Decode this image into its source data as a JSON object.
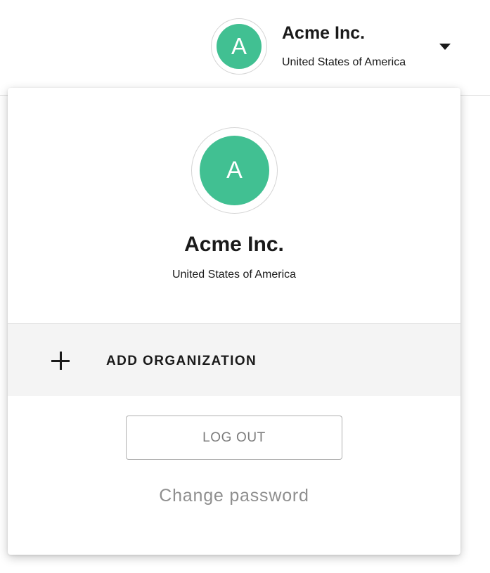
{
  "header": {
    "org_initial": "A",
    "org_name": "Acme Inc.",
    "org_country": "United States of America",
    "caret_icon": "caret-down-icon"
  },
  "menu": {
    "avatar_initial": "A",
    "org_name": "Acme Inc.",
    "org_country": "United States of America",
    "add_org_icon": "plus-icon",
    "add_org_label": "ADD ORGANIZATION",
    "logout_label": "LOG OUT",
    "change_password_label": "Change password"
  },
  "colors": {
    "avatar_bg": "#41c092",
    "avatar_text": "#ffffff",
    "add_org_bg": "#f4f4f4",
    "muted_text": "#8f8f8f"
  }
}
